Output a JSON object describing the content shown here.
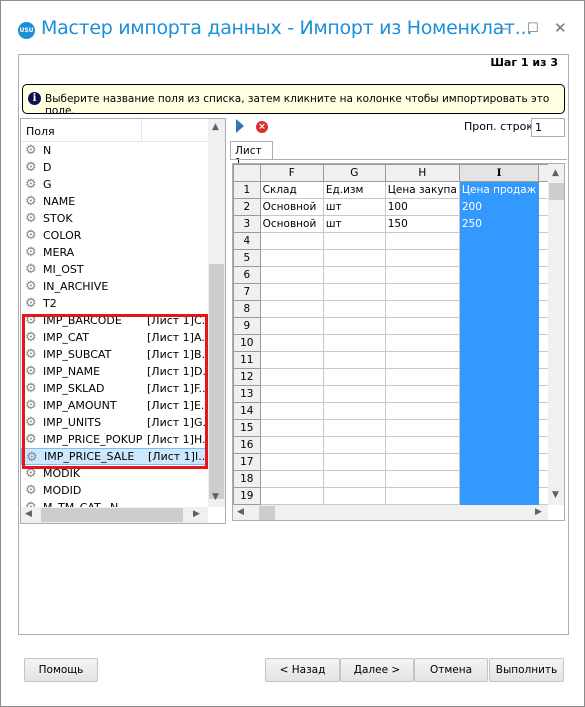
{
  "window": {
    "title": "Мастер импорта данных - Импорт из Номенклат...",
    "app_icon_text": "USU",
    "minimize": "–",
    "maximize": "☐",
    "close": "✕"
  },
  "step": "Шаг 1 из 3",
  "info": "Выберите название поля из списка, затем кликните на колонке чтобы импортировать это поле.",
  "fields": {
    "header": "Поля",
    "items": [
      {
        "name": "N",
        "map": ""
      },
      {
        "name": "D",
        "map": ""
      },
      {
        "name": "G",
        "map": ""
      },
      {
        "name": "NAME",
        "map": ""
      },
      {
        "name": "STOK",
        "map": ""
      },
      {
        "name": "COLOR",
        "map": ""
      },
      {
        "name": "MERA",
        "map": ""
      },
      {
        "name": "MI_OST",
        "map": ""
      },
      {
        "name": "IN_ARCHIVE",
        "map": ""
      },
      {
        "name": "T2",
        "map": ""
      },
      {
        "name": "IMP_BARCODE",
        "map": "[Лист 1]C..."
      },
      {
        "name": "IMP_CAT",
        "map": "[Лист 1]A..."
      },
      {
        "name": "IMP_SUBCAT",
        "map": "[Лист 1]B..."
      },
      {
        "name": "IMP_NAME",
        "map": "[Лист 1]D..."
      },
      {
        "name": "IMP_SKLAD",
        "map": "[Лист 1]F..."
      },
      {
        "name": "IMP_AMOUNT",
        "map": "[Лист 1]E..."
      },
      {
        "name": "IMP_UNITS",
        "map": "[Лист 1]G..."
      },
      {
        "name": "IMP_PRICE_POKUP",
        "map": "[Лист 1]H..."
      },
      {
        "name": "IMP_PRICE_SALE",
        "map": "[Лист 1]I...",
        "selected": true
      },
      {
        "name": "MODIK",
        "map": ""
      },
      {
        "name": "MODID",
        "map": ""
      },
      {
        "name": "M_TM_CAT...N",
        "map": ""
      }
    ]
  },
  "toolbar": {
    "skip_label": "Проп. строк",
    "skip_value": "1"
  },
  "sheet_tab": "Лист 1",
  "grid": {
    "columns": [
      "F",
      "G",
      "H",
      "I",
      ""
    ],
    "selected_column": "I",
    "rows": [
      [
        "Склад",
        "Ед.изм",
        "Цена закупа",
        "Цена продаж",
        ""
      ],
      [
        "Основной",
        "шт",
        "100",
        "200",
        ""
      ],
      [
        "Основной",
        "шт",
        "150",
        "250",
        ""
      ]
    ],
    "row_count": 19
  },
  "buttons": {
    "help": "Помощь",
    "back": "< Назад",
    "next": "Далее >",
    "cancel": "Отмена",
    "finish": "Выполнить"
  },
  "colors": {
    "accent": "#1c8fd9",
    "selection": "#3399ff",
    "highlight_box": "#e8141b",
    "info_bg": "#ffffe1"
  }
}
